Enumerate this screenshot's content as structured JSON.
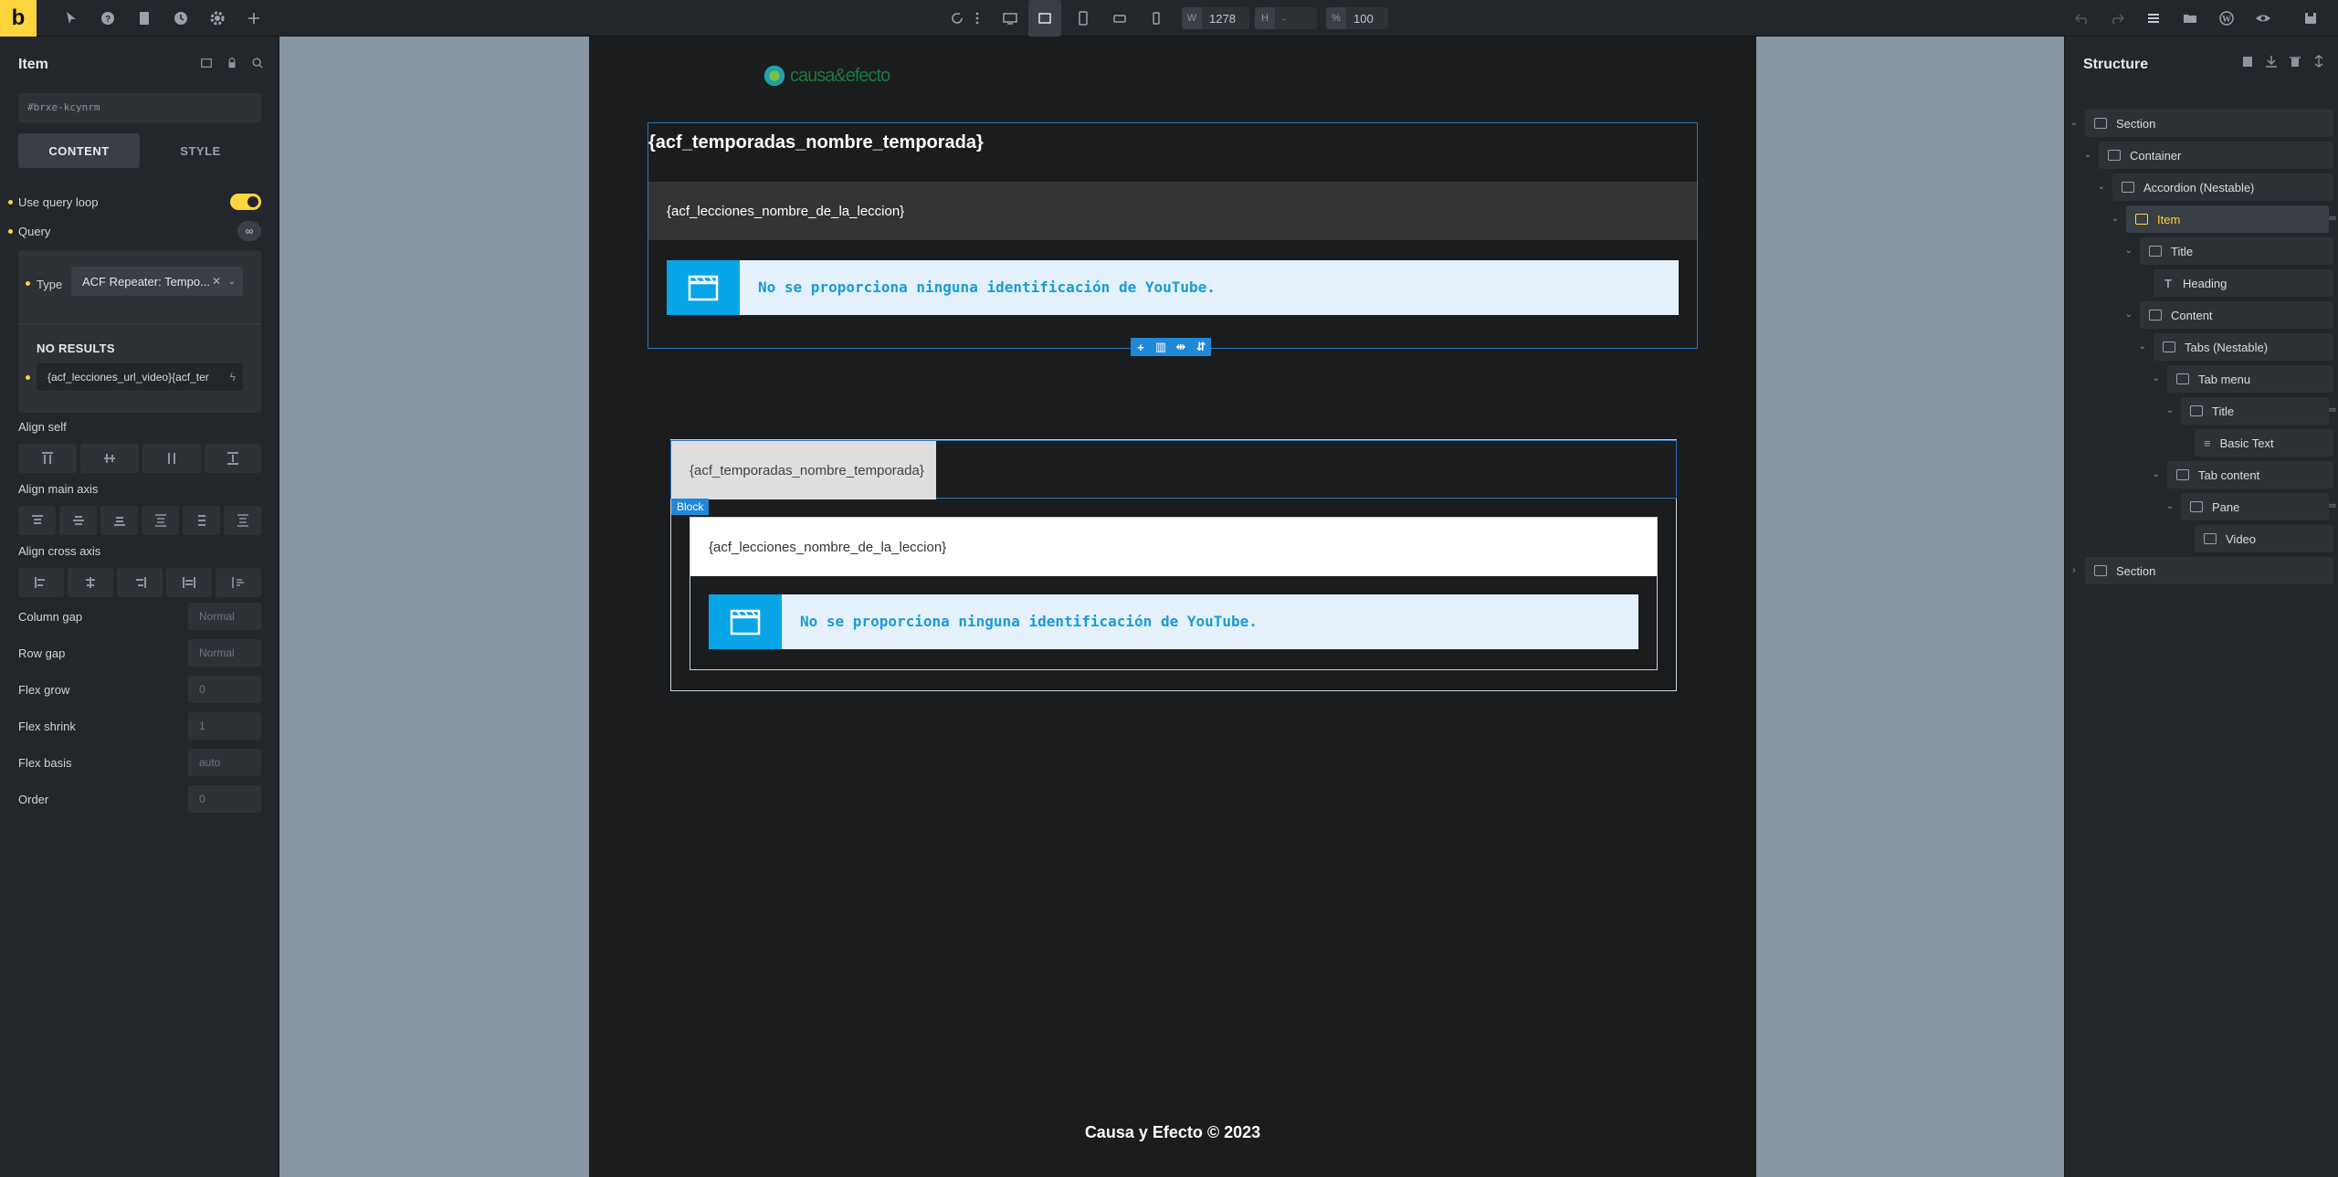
{
  "topbar": {
    "logo": "b",
    "width_label": "W",
    "width_value": "1278",
    "height_label": "H",
    "height_value": "-",
    "zoom_label": "%",
    "zoom_value": "100"
  },
  "left_panel": {
    "title": "Item",
    "element_id": "#brxe-kcynrm",
    "tabs": [
      "CONTENT",
      "STYLE"
    ],
    "use_query_loop_label": "Use query loop",
    "query_label": "Query",
    "type_label": "Type",
    "type_value": "ACF Repeater: Tempo...",
    "no_results": "NO RESULTS",
    "query_input": "{acf_lecciones_url_video}{acf_ter",
    "align_self_label": "Align self",
    "align_main_label": "Align main axis",
    "align_cross_label": "Align cross axis",
    "column_gap_label": "Column gap",
    "column_gap_ph": "Normal",
    "row_gap_label": "Row gap",
    "row_gap_ph": "Normal",
    "flex_grow_label": "Flex grow",
    "flex_grow_ph": "0",
    "flex_shrink_label": "Flex shrink",
    "flex_shrink_ph": "1",
    "flex_basis_label": "Flex basis",
    "flex_basis_ph": "auto",
    "order_label": "Order",
    "order_ph": "0"
  },
  "canvas": {
    "brand": "causa&efecto",
    "acc_title": "{acf_temporadas_nombre_temporada}",
    "acc_content_title": "{acf_lecciones_nombre_de_la_leccion}",
    "video_msg": "No se proporciona ninguna identificación de YouTube.",
    "tab_title": "{acf_temporadas_nombre_temporada}",
    "block_label": "Block",
    "pane_title": "{acf_lecciones_nombre_de_la_leccion}",
    "video_msg2": "No se proporciona ninguna identificación de YouTube.",
    "footer": "Causa y Efecto © 2023"
  },
  "structure": {
    "title": "Structure",
    "nodes": [
      {
        "label": "Section"
      },
      {
        "label": "Container"
      },
      {
        "label": "Accordion (Nestable)"
      },
      {
        "label": "Item"
      },
      {
        "label": "Title"
      },
      {
        "label": "Heading"
      },
      {
        "label": "Content"
      },
      {
        "label": "Tabs (Nestable)"
      },
      {
        "label": "Tab menu"
      },
      {
        "label": "Title"
      },
      {
        "label": "Basic Text"
      },
      {
        "label": "Tab content"
      },
      {
        "label": "Pane"
      },
      {
        "label": "Video"
      },
      {
        "label": "Section"
      }
    ]
  },
  "colors": {
    "accent": "#ffd53e",
    "selection": "#2a74b8",
    "video_icon": "#08a4e8"
  }
}
